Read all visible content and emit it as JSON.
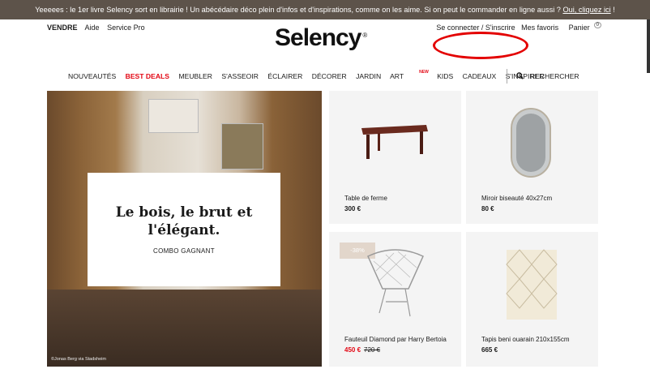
{
  "banner": {
    "text": "Yeeeees  : le 1er livre Selency sort en librairie ! Un abécédaire déco plein d'infos et d'inspirations, comme on les aime. Si on peut le commander en ligne aussi ? ",
    "link": "Oui, cliquez ici",
    "end": " !"
  },
  "header": {
    "left_links": [
      "VENDRE",
      "Aide",
      "Service Pro"
    ],
    "logo": "Selency",
    "logo_mark": "®",
    "login": "Se connecter / S'inscrire",
    "favorites": "Mes favoris",
    "cart": "Panier",
    "cart_count": "0"
  },
  "nav": {
    "items": [
      "NOUVEAUTÉS",
      "BEST DEALS",
      "MEUBLER",
      "S'ASSEOIR",
      "ÉCLAIRER",
      "DÉCORER",
      "JARDIN",
      "ART",
      "KIDS",
      "CADEAUX",
      "S'INSPIRER"
    ],
    "new_tag": "NEW",
    "search": "RECHERCHER"
  },
  "hero": {
    "title": "Le bois, le brut et l'élégant.",
    "subtitle": "COMBO GAGNANT",
    "credit": "©Jonas Berg via Stadsheim"
  },
  "products": [
    {
      "name": "Table de ferme",
      "price": "300 €"
    },
    {
      "name": "Miroir biseauté 40x27cm",
      "price": "80 €"
    },
    {
      "name": "Fauteuil Diamond par Harry Bertoia",
      "price": "450 €",
      "old_price": "720 €",
      "discount": "-38%"
    },
    {
      "name": "Tapis beni ouarain 210x155cm",
      "price": "665 €"
    }
  ],
  "colors": {
    "accent": "#e30613",
    "banner_bg": "#5d534a",
    "annotation": "#e30000"
  }
}
